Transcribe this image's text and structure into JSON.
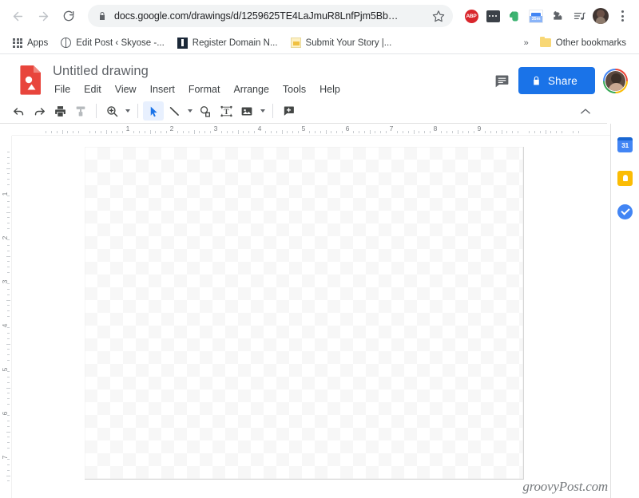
{
  "browser": {
    "nav": {
      "back_label": "Back",
      "forward_label": "Forward",
      "reload_label": "Reload"
    },
    "omnibox": {
      "url": "docs.google.com/drawings/d/1259625TE4LaJmuR8LnfPjm5Bb…",
      "secure_icon": "lock-icon",
      "bookmark_icon": "star-icon"
    },
    "extensions": [
      {
        "name": "adblock-plus",
        "label": "ABP"
      },
      {
        "name": "dots-extension",
        "label": ""
      },
      {
        "name": "evernote",
        "label": ""
      },
      {
        "name": "timer-extension",
        "label": "35m"
      },
      {
        "name": "extensions-puzzle",
        "label": ""
      },
      {
        "name": "media-list",
        "label": ""
      }
    ],
    "profile_label": "Profile",
    "menu_label": "Customize and control Google Chrome"
  },
  "bookmarks": {
    "apps_label": "Apps",
    "items": [
      {
        "label": "Edit Post ‹ Skyose -...",
        "icon": "globe-icon"
      },
      {
        "label": "Register Domain N...",
        "icon": "dark-square-icon"
      },
      {
        "label": "Submit Your Story |...",
        "icon": "yellow-note-icon"
      }
    ],
    "overflow_label": "»",
    "other_bookmarks_label": "Other bookmarks"
  },
  "docs": {
    "title": "Untitled drawing",
    "logo_name": "google-drawings-logo",
    "menus": [
      "File",
      "Edit",
      "View",
      "Insert",
      "Format",
      "Arrange",
      "Tools",
      "Help"
    ],
    "comment_label": "Comment",
    "share_label": "Share",
    "share_color": "#1a73e8",
    "share_lock_icon": "lock-icon",
    "account_label": "Google Account"
  },
  "toolbar": {
    "items": [
      {
        "name": "undo-button",
        "icon": "undo-icon",
        "caret": false,
        "selected": false
      },
      {
        "name": "redo-button",
        "icon": "redo-icon",
        "caret": false,
        "selected": false
      },
      {
        "name": "print-button",
        "icon": "print-icon",
        "caret": false,
        "selected": false
      },
      {
        "name": "paint-format-button",
        "icon": "paint-format-icon",
        "caret": false,
        "selected": false
      },
      {
        "name": "divider",
        "icon": "divider",
        "caret": false,
        "selected": false
      },
      {
        "name": "zoom-button",
        "icon": "zoom-icon",
        "caret": true,
        "selected": false
      },
      {
        "name": "divider",
        "icon": "divider",
        "caret": false,
        "selected": false
      },
      {
        "name": "select-tool-button",
        "icon": "cursor-arrow-icon",
        "caret": false,
        "selected": true
      },
      {
        "name": "line-tool-button",
        "icon": "line-icon",
        "caret": true,
        "selected": false
      },
      {
        "name": "shape-tool-button",
        "icon": "shape-icon",
        "caret": false,
        "selected": false
      },
      {
        "name": "text-box-button",
        "icon": "text-box-icon",
        "caret": false,
        "selected": false
      },
      {
        "name": "image-button",
        "icon": "image-icon",
        "caret": true,
        "selected": false
      },
      {
        "name": "divider",
        "icon": "divider",
        "caret": false,
        "selected": false
      },
      {
        "name": "add-comment-button",
        "icon": "comment-plus-icon",
        "caret": false,
        "selected": false
      }
    ],
    "collapse_label": "⌃"
  },
  "ruler": {
    "horizontal_marks": [
      "1",
      "2",
      "3",
      "4",
      "5",
      "6",
      "7",
      "8",
      "9"
    ],
    "vertical_marks": [
      "1",
      "2",
      "3",
      "4",
      "5",
      "6",
      "7"
    ],
    "unit_spacing_px": 55
  },
  "canvas": {
    "background": "transparent-checkerboard",
    "watermark": "groovyPost.com"
  },
  "side_panel": {
    "items": [
      {
        "name": "google-calendar",
        "label": "31"
      },
      {
        "name": "google-keep",
        "label": ""
      },
      {
        "name": "google-tasks",
        "label": ""
      }
    ]
  }
}
